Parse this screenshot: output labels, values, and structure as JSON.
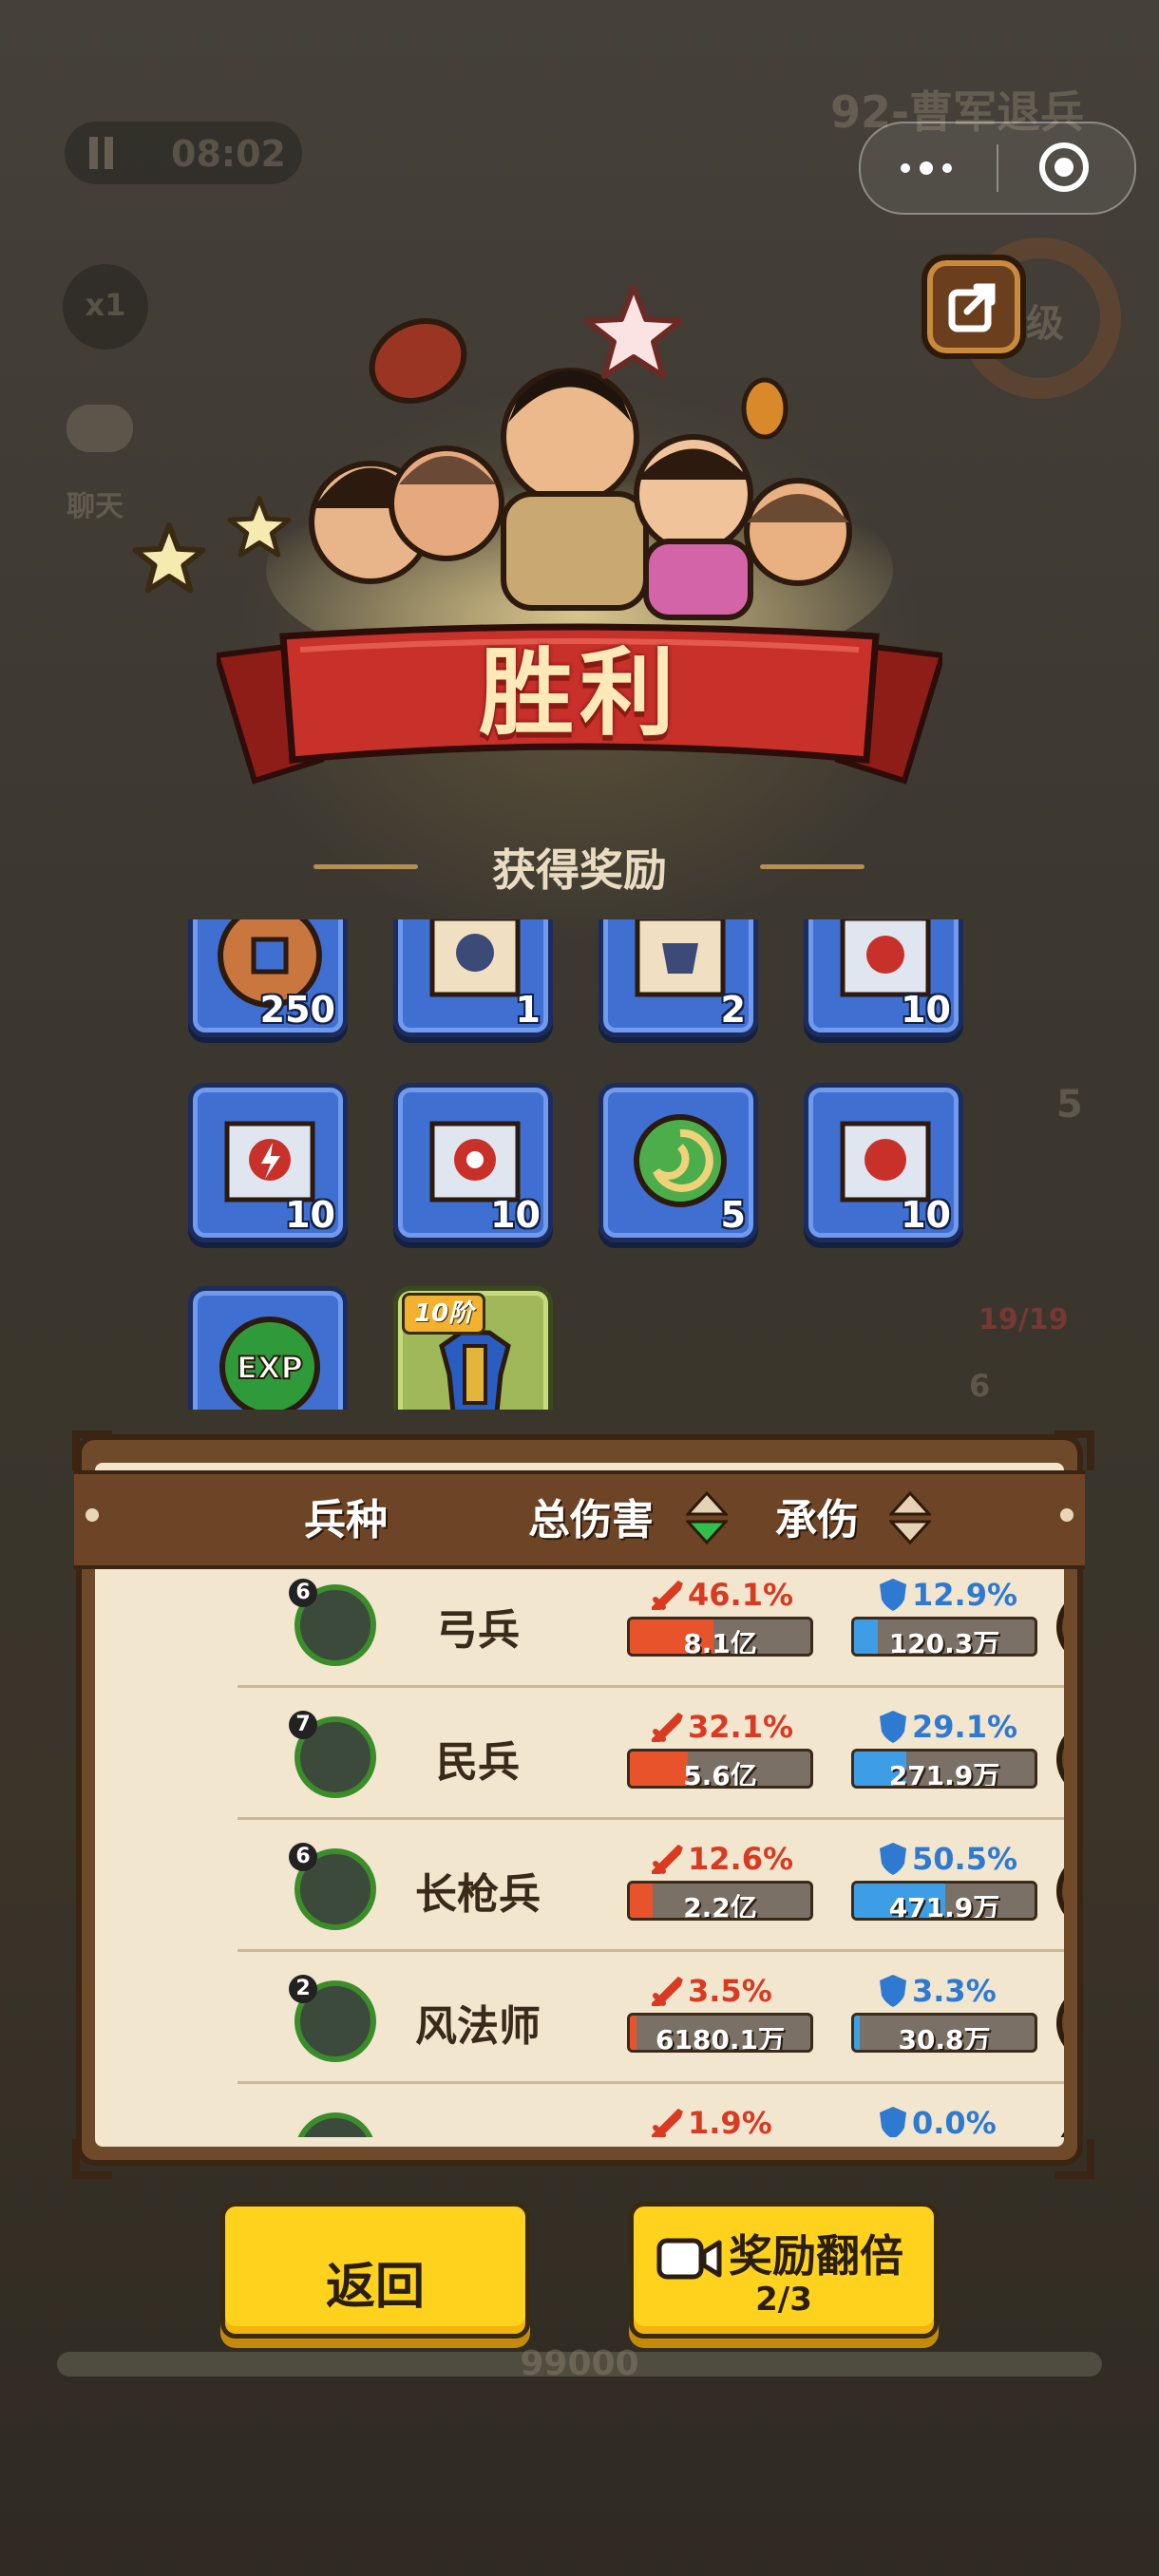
{
  "hud": {
    "timer": "08:02",
    "speed": "x1",
    "chat": "聊天",
    "stage_title": "92-曹军退兵",
    "level_partial": "0级",
    "side_count": "5",
    "troop_count": "19/19",
    "side_level": "6",
    "progress_value": "99000"
  },
  "result": {
    "title": "胜利",
    "reward_title": "获得奖励"
  },
  "rewards": [
    {
      "icon": "copper-coin-icon",
      "count": "250"
    },
    {
      "icon": "scroll-runner-icon",
      "count": "1"
    },
    {
      "icon": "scroll-armor-icon",
      "count": "2"
    },
    {
      "icon": "scroll-horse-icon",
      "count": "10"
    },
    {
      "icon": "scroll-lightning-icon",
      "count": "10"
    },
    {
      "icon": "scroll-swirl-icon",
      "count": "10"
    },
    {
      "icon": "jade-swirl-icon",
      "count": "5"
    },
    {
      "icon": "scroll-tiger-icon",
      "count": "10"
    },
    {
      "icon": "exp-orb-icon",
      "count": ""
    },
    {
      "icon": "armor-icon",
      "count": "",
      "tag": "10阶"
    }
  ],
  "stats": {
    "columns": [
      "兵种",
      "总伤害",
      "承伤"
    ],
    "rows": [
      {
        "level": "6",
        "name": "弓兵",
        "damage_pct": "46.1%",
        "damage": "8.1亿",
        "damage_frac": 0.461,
        "taken_pct": "12.9%",
        "taken": "120.3万",
        "taken_frac": 0.129
      },
      {
        "level": "7",
        "name": "民兵",
        "damage_pct": "32.1%",
        "damage": "5.6亿",
        "damage_frac": 0.321,
        "taken_pct": "29.1%",
        "taken": "271.9万",
        "taken_frac": 0.291
      },
      {
        "level": "6",
        "name": "长枪兵",
        "damage_pct": "12.6%",
        "damage": "2.2亿",
        "damage_frac": 0.126,
        "taken_pct": "50.5%",
        "taken": "471.9万",
        "taken_frac": 0.505
      },
      {
        "level": "2",
        "name": "风法师",
        "damage_pct": "3.5%",
        "damage": "6180.1万",
        "damage_frac": 0.035,
        "taken_pct": "3.3%",
        "taken": "30.8万",
        "taken_frac": 0.033
      },
      {
        "level": "",
        "name": "",
        "damage_pct": "1.9%",
        "damage": "",
        "damage_frac": 0.019,
        "taken_pct": "0.0%",
        "taken": "",
        "taken_frac": 0.0
      }
    ]
  },
  "buttons": {
    "back": "返回",
    "double": "奖励翻倍",
    "double_count": "2/3"
  },
  "colors": {
    "damage_bar": "#e9532b",
    "taken_bar": "#3d9ee6",
    "button": "#ffd21e",
    "banner_red": "#c8302a"
  }
}
